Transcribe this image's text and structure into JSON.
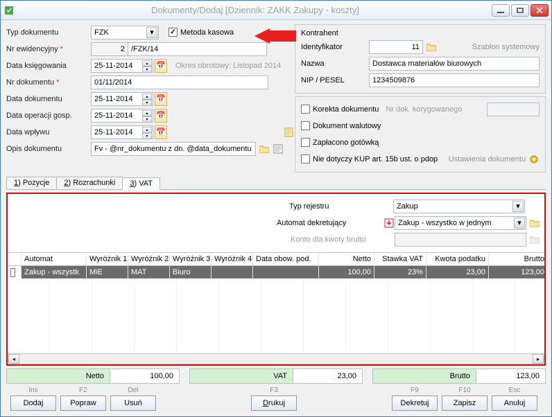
{
  "window": {
    "title": "Dokumenty/Dodaj [Dziennik: ZAKK  Zakupy - koszty]"
  },
  "left": {
    "typ_label": "Typ dokumentu",
    "typ_value": "FZK",
    "metoda_kasowa": "Metoda kasowa",
    "nr_ewid_label": "Nr ewidencyjny",
    "nr_ewid_value": "2",
    "nr_ewid_suffix": "/FZK/14",
    "data_ksieg_label": "Data księgowania",
    "data_ksieg": "25-11-2014",
    "okres": "Okres obrotowy: Listopad 2014",
    "nr_dok_label": "Nr dokumentu",
    "nr_dok": "01/11/2014",
    "data_dok_label": "Data dokumentu",
    "data_dok": "25-11-2014",
    "data_oper_label": "Data operacji gosp.",
    "data_oper": "25-11-2014",
    "data_wplywu_label": "Data wpływu",
    "data_wplywu": "25-11-2014",
    "opis_label": "Opis dokumentu",
    "opis": "Fv - @nr_dokumentu z dn. @data_dokumentu"
  },
  "right": {
    "kontrahent_label": "Kontrahent",
    "ident_label": "Identyfikator",
    "ident_value": "11",
    "szablon": "Szablon systemowy",
    "nazwa_label": "Nazwa",
    "nazwa": "Dostawca materiałów biurowych",
    "nip_label": "NIP / PESEL",
    "nip": "1234509876",
    "korekta": "Korekta dokumentu",
    "korekta_nr": "Nr dok. korygowanego",
    "walutowy": "Dokument walutowy",
    "gotowka": "Zapłacono gotówką",
    "kup": "Nie dotyczy KUP art. 15b ust. o pdop",
    "ustawienia": "Ustawienia dokumentu"
  },
  "tabs": {
    "t1": "1) Pozycje",
    "t2": "2) Rozrachunki",
    "t3_pre": "3",
    "t3_rest": ") VAT"
  },
  "vat": {
    "typ_rej_label": "Typ rejestru",
    "typ_rej": "Zakup",
    "auto_label": "Automat dekretujący",
    "auto_val": "Zakup - wszystko w jednym",
    "konto_label": "Konto dla kwoty brutto",
    "konto_val": "",
    "headers": {
      "auto": "Automat",
      "w1": "Wyróżnik 1",
      "w2": "Wyróżnik 2",
      "w3": "Wyróżnik 3",
      "w4": "Wyróżnik 4",
      "dop": "Data obow. pod.",
      "netto": "Netto",
      "stawka": "Stawka VAT",
      "kwp": "Kwota podatku",
      "brutto": "Brutto"
    },
    "row": {
      "auto": "Zakup - wszystk",
      "w1": "MiE",
      "w2": "MAT",
      "w3": "Biuro",
      "w4": "",
      "dop": "",
      "netto": "100,00",
      "stawka": "23%",
      "kwp": "23,00",
      "brutto": "123,00"
    }
  },
  "totals": {
    "netto_l": "Netto",
    "netto": "100,00",
    "vat_l": "VAT",
    "vat": "23,00",
    "brutto_l": "Brutto",
    "brutto": "123,00"
  },
  "buttons": {
    "ins": "Ins",
    "dodaj": "Dodaj",
    "f2": "F2",
    "popraw": "Popraw",
    "del": "Del",
    "usun": "Usuń",
    "f3": "F3",
    "drukuj_pre": "D",
    "drukuj_rest": "rukuj",
    "f9": "F9",
    "dekretuj": "Dekretuj",
    "f10": "F10",
    "zapisz": "Zapisz",
    "esc": "Esc",
    "anuluj": "Anuluj"
  }
}
